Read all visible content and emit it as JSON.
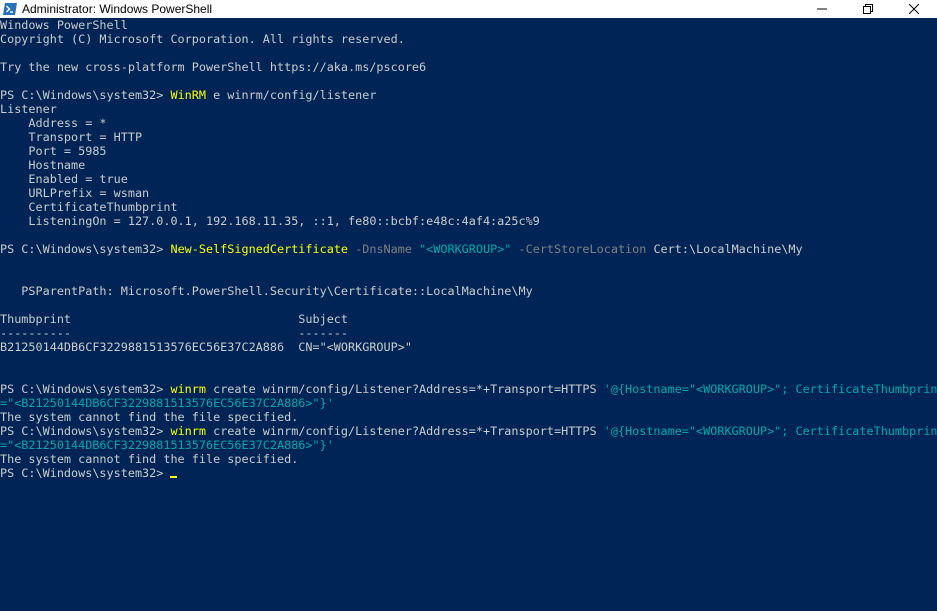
{
  "window": {
    "title": "Administrator: Windows PowerShell",
    "icon": "powershell-icon",
    "controls": [
      "minimize-icon",
      "restore-icon",
      "close-icon"
    ]
  },
  "colors": {
    "background": "#012456",
    "text": "#cccccc",
    "command": "#ffff00",
    "parameter": "#808080",
    "string": "#00aaaa"
  },
  "console": {
    "lines": [
      [
        {
          "t": "Windows PowerShell",
          "c": "plain"
        }
      ],
      [
        {
          "t": "Copyright (C) Microsoft Corporation. All rights reserved.",
          "c": "plain"
        }
      ],
      [],
      [
        {
          "t": "Try the new cross-platform PowerShell https://aka.ms/pscore6",
          "c": "plain"
        }
      ],
      [],
      [
        {
          "t": "PS C:\\Windows\\system32> ",
          "c": "plain"
        },
        {
          "t": "WinRM",
          "c": "cmd"
        },
        {
          "t": " e winrm/config/listener",
          "c": "plain"
        }
      ],
      [
        {
          "t": "Listener",
          "c": "plain"
        }
      ],
      [
        {
          "t": "    Address = *",
          "c": "plain"
        }
      ],
      [
        {
          "t": "    Transport = HTTP",
          "c": "plain"
        }
      ],
      [
        {
          "t": "    Port = 5985",
          "c": "plain"
        }
      ],
      [
        {
          "t": "    Hostname",
          "c": "plain"
        }
      ],
      [
        {
          "t": "    Enabled = true",
          "c": "plain"
        }
      ],
      [
        {
          "t": "    URLPrefix = wsman",
          "c": "plain"
        }
      ],
      [
        {
          "t": "    CertificateThumbprint",
          "c": "plain"
        }
      ],
      [
        {
          "t": "    ListeningOn = 127.0.0.1, 192.168.11.35, ::1, fe80::bcbf:e48c:4af4:a25c%9",
          "c": "plain"
        }
      ],
      [],
      [
        {
          "t": "PS C:\\Windows\\system32> ",
          "c": "plain"
        },
        {
          "t": "New-SelfSignedCertificate",
          "c": "cmd"
        },
        {
          "t": " -DnsName ",
          "c": "param"
        },
        {
          "t": "\"<WORKGROUP>\"",
          "c": "str"
        },
        {
          "t": " -CertStoreLocation ",
          "c": "param"
        },
        {
          "t": "Cert:\\LocalMachine\\My",
          "c": "plain"
        }
      ],
      [],
      [],
      [
        {
          "t": "   PSParentPath: Microsoft.PowerShell.Security\\Certificate::LocalMachine\\My",
          "c": "plain"
        }
      ],
      [],
      [
        {
          "t": "Thumbprint                                Subject",
          "c": "plain"
        }
      ],
      [
        {
          "t": "----------                                -------",
          "c": "plain"
        }
      ],
      [
        {
          "t": "B21250144DB6CF3229881513576EC56E37C2A886  CN=\"<WORKGROUP>\"",
          "c": "plain"
        }
      ],
      [],
      [],
      [
        {
          "t": "PS C:\\Windows\\system32> ",
          "c": "plain"
        },
        {
          "t": "winrm",
          "c": "cmd"
        },
        {
          "t": " create winrm/config/Listener?Address=*+Transport=HTTPS ",
          "c": "plain"
        },
        {
          "t": "'@{Hostname=\"<WORKGROUP>\"; CertificateThumbprint",
          "c": "str"
        }
      ],
      [
        {
          "t": "=\"<B21250144DB6CF3229881513576EC56E37C2A886>\"}'",
          "c": "str"
        }
      ],
      [
        {
          "t": "The system cannot find the file specified.",
          "c": "plain"
        }
      ],
      [
        {
          "t": "PS C:\\Windows\\system32> ",
          "c": "plain"
        },
        {
          "t": "winrm",
          "c": "cmd"
        },
        {
          "t": " create winrm/config/Listener?Address=*+Transport=HTTPS ",
          "c": "plain"
        },
        {
          "t": "'@{Hostname=\"<WORKGROUP>\"; CertificateThumbprint",
          "c": "str"
        }
      ],
      [
        {
          "t": "=\"<B21250144DB6CF3229881513576EC56E37C2A886>\"}'",
          "c": "str"
        }
      ],
      [
        {
          "t": "The system cannot find the file specified.",
          "c": "plain"
        }
      ],
      [
        {
          "t": "PS C:\\Windows\\system32> ",
          "c": "plain"
        },
        {
          "t": "",
          "c": "cursor"
        }
      ]
    ]
  }
}
